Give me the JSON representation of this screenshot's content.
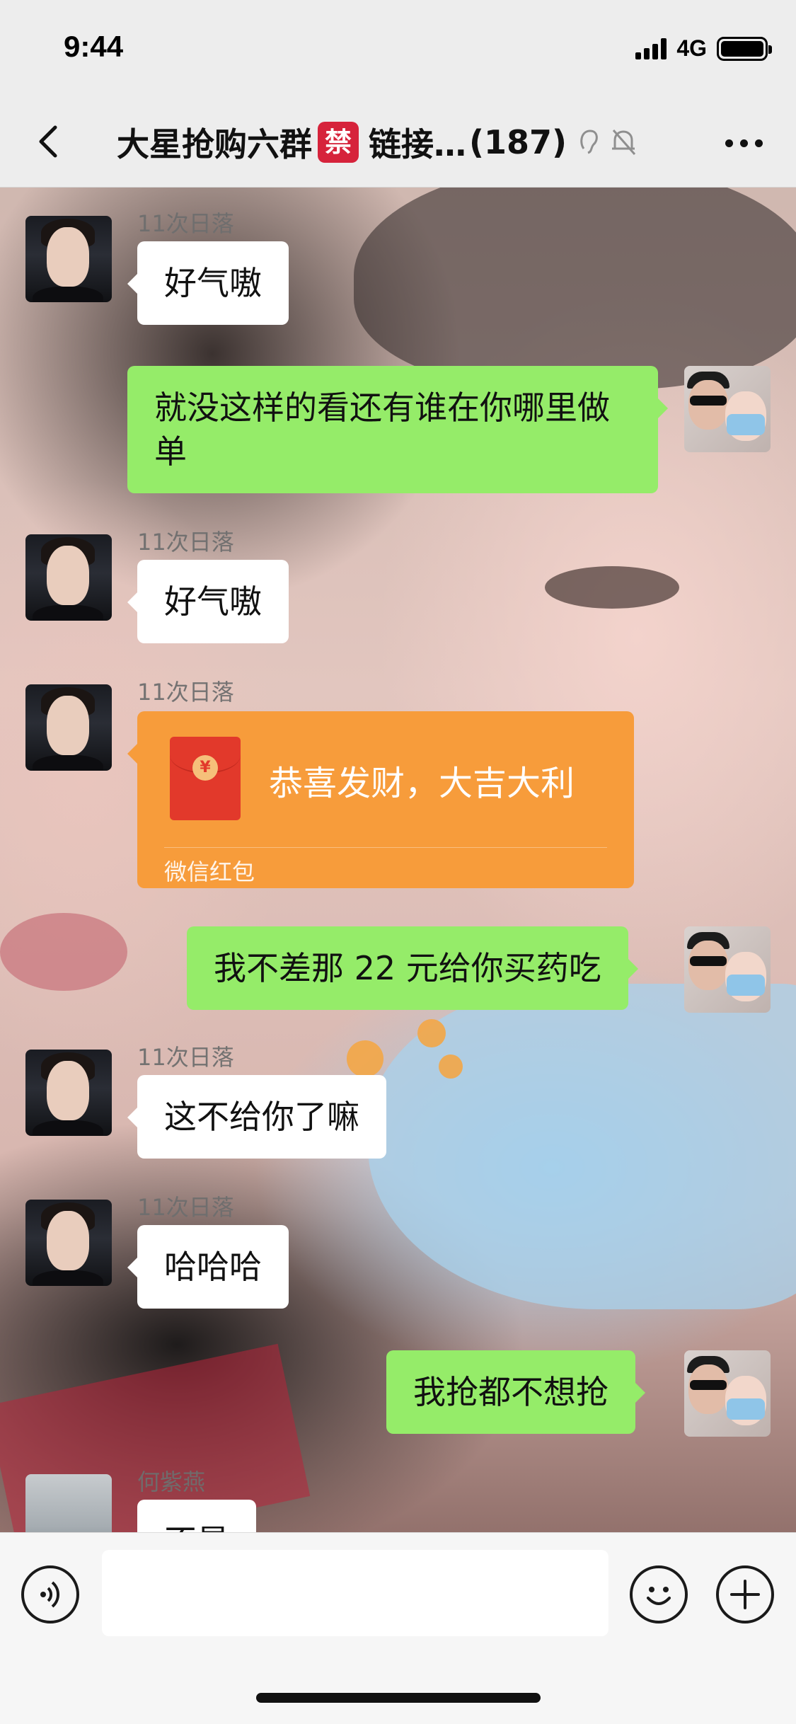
{
  "status_bar": {
    "time": "9:44",
    "network": "4G"
  },
  "header": {
    "title_prefix": "大星抢购六群",
    "badge": "禁",
    "title_suffix": "链接…",
    "member_count": "(187)"
  },
  "messages": [
    {
      "side": "left",
      "sender": "11次日落",
      "text": "好气嗷"
    },
    {
      "side": "right",
      "text": "就没这样的看还有谁在你哪里做单"
    },
    {
      "side": "left",
      "sender": "11次日落",
      "text": "好气嗷"
    },
    {
      "side": "left",
      "sender": "11次日落",
      "type": "red_packet",
      "title": "恭喜发财，大吉大利",
      "footer": "微信红包"
    },
    {
      "side": "right",
      "text": "我不差那 22 元给你买药吃"
    },
    {
      "side": "left",
      "sender": "11次日落",
      "text": "这不给你了嘛"
    },
    {
      "side": "left",
      "sender": "11次日落",
      "text": "哈哈哈"
    },
    {
      "side": "right",
      "text": "我抢都不想抢"
    },
    {
      "side": "left",
      "sender": "何紫燕",
      "text": "不是"
    }
  ],
  "colors": {
    "self_bubble": "#95ec69",
    "red_packet": "#f79c3b",
    "badge": "#d6233b"
  },
  "icons": {
    "back": "chevron-left-icon",
    "more": "more-dots-icon",
    "voice": "voice-icon",
    "emoji": "emoji-icon",
    "plus": "plus-icon"
  }
}
